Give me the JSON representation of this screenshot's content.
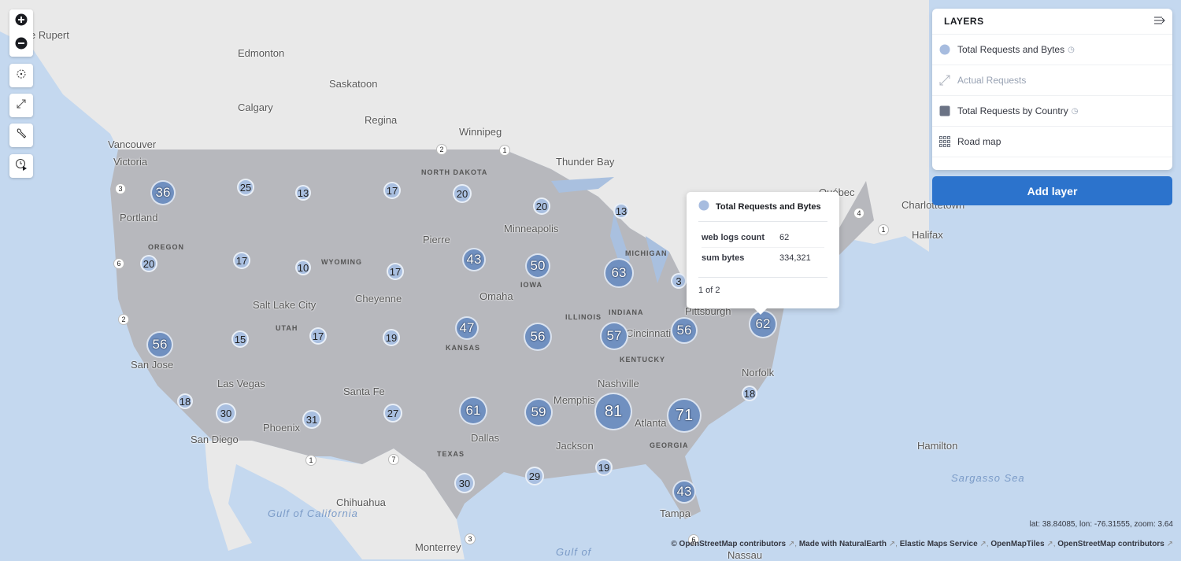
{
  "map": {
    "colors": {
      "ocean": "#c4d8ef",
      "land": "#e9e9e9",
      "us_region": "#b7b8bd",
      "cluster_dark": "#7090c0",
      "cluster_light": "#a9bfe0"
    },
    "cities": [
      "e Rupert",
      "Edmonton",
      "Saskatoon",
      "Calgary",
      "Regina",
      "Winnipeg",
      "Vancouver",
      "Victoria",
      "Thunder Bay",
      "Portland",
      "Minneapolis",
      "Pierre",
      "Omaha",
      "Salt Lake City",
      "Cheyenne",
      "Pittsburgh",
      "Cincinnati",
      "San Jose",
      "Las Vegas",
      "Santa Fe",
      "Nashville",
      "Memphis",
      "Atlanta",
      "Norfolk",
      "Phoenix",
      "Dallas",
      "Jackson",
      "San Diego",
      "Chihuahua",
      "Tampa",
      "Monterrey",
      "Nassau",
      "Hamilton",
      "Halifax",
      "Charlottetown",
      "Québec"
    ],
    "states": [
      "NORTH DAKOTA",
      "OREGON",
      "WYOMING",
      "IOWA",
      "MICHIGAN",
      "UTAH",
      "KANSAS",
      "ILLINOIS",
      "INDIANA",
      "KENTUCKY",
      "TEXAS",
      "GEORGIA"
    ],
    "water": [
      "Gulf of California",
      "Sargasso Sea",
      "Gulf of"
    ],
    "clusters": [
      36,
      25,
      13,
      17,
      20,
      20,
      13,
      3,
      2,
      1,
      6,
      20,
      17,
      10,
      17,
      43,
      50,
      63,
      3,
      2,
      56,
      15,
      17,
      19,
      47,
      56,
      57,
      56,
      62,
      18,
      30,
      31,
      27,
      61,
      59,
      81,
      71,
      18,
      1,
      7,
      30,
      29,
      19,
      43,
      6,
      3,
      4,
      1
    ]
  },
  "toolbar": {
    "icons": [
      "plus-circle-icon",
      "minus-circle-icon",
      "crosshair-icon",
      "expand-icon",
      "wrench-icon",
      "timeslider-icon"
    ]
  },
  "layers": {
    "title": "LAYERS",
    "items": [
      {
        "label": "Total Requests and Bytes",
        "icon": "circle",
        "color": "#a7bcdf",
        "time": true
      },
      {
        "label": "Actual Requests",
        "icon": "line",
        "color": "#98a2b3",
        "time": false,
        "hidden": true
      },
      {
        "label": "Total Requests by Country",
        "icon": "square",
        "color": "#6b7385",
        "time": true
      },
      {
        "label": "Road map",
        "icon": "grid",
        "color": "#69707d",
        "time": false
      }
    ],
    "add_label": "Add layer"
  },
  "tooltip": {
    "layer": "Total Requests and Bytes",
    "rows": [
      {
        "key": "web logs count",
        "value": "62"
      },
      {
        "key": "sum bytes",
        "value": "334,321"
      }
    ],
    "pager": "1 of 2"
  },
  "status": {
    "coords": "lat: 38.84085, lon: -76.31555, zoom: 3.64"
  },
  "attribution": [
    "© OpenStreetMap contributors",
    "Made with NaturalEarth",
    "Elastic Maps Service",
    "OpenMapTiles",
    "OpenStreetMap contributors"
  ]
}
